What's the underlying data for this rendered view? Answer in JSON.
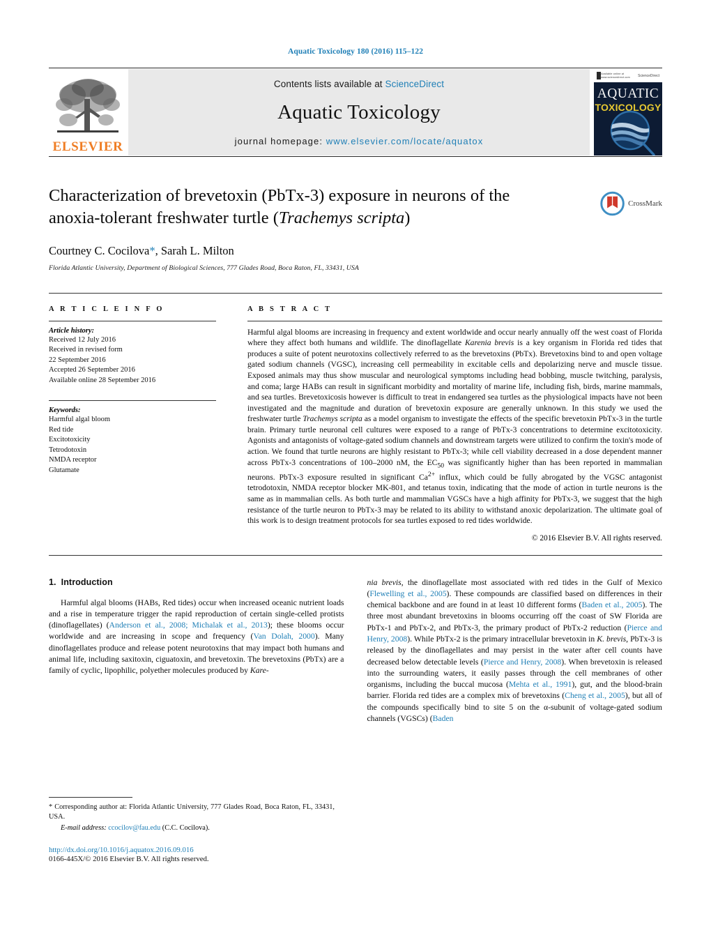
{
  "running_head": "Aquatic Toxicology 180 (2016) 115–122",
  "banner": {
    "publisher_name": "ELSEVIER",
    "contents_prefix": "Contents lists available at ",
    "contents_link": "ScienceDirect",
    "journal_title": "Aquatic Toxicology",
    "homepage_prefix": "journal homepage: ",
    "homepage_url": "www.elsevier.com/locate/aquatox",
    "cover": {
      "line1": "AQUATIC",
      "line2": "TOXICOLOGY",
      "masthead_small": "Available online at www.sciencedirect.com",
      "masthead_right": "ScienceDirect"
    }
  },
  "article": {
    "title_line1": "Characterization of brevetoxin (PbTx-3) exposure in neurons of the",
    "title_line2_pre": "anoxia-tolerant freshwater turtle (",
    "title_line2_italic": "Trachemys scripta",
    "title_line2_post": ")",
    "authors_pre": "Courtney C. Cocilova",
    "authors_star": "*",
    "authors_post": ", Sarah L. Milton",
    "affiliation": "Florida Atlantic University, Department of Biological Sciences, 777 Glades Road, Boca Raton, FL, 33431, USA",
    "crossmark_label": "CrossMark"
  },
  "article_info": {
    "heading": "A R T I C L E   I N F O",
    "history_label": "Article history:",
    "history_lines": [
      "Received 12 July 2016",
      "Received in revised form",
      "22 September 2016",
      "Accepted 26 September 2016",
      "Available online 28 September 2016"
    ],
    "keywords_label": "Keywords:",
    "keywords": [
      "Harmful algal bloom",
      "Red tide",
      "Excitotoxicity",
      "Tetrodotoxin",
      "NMDA receptor",
      "Glutamate"
    ]
  },
  "abstract": {
    "heading": "A B S T R A C T",
    "part1": "Harmful algal blooms are increasing in frequency and extent worldwide and occur nearly annually off the west coast of Florida where they affect both humans and wildlife. The dinoflagellate ",
    "italic1": "Karenia brevis",
    "part2": " is a key organism in Florida red tides that produces a suite of potent neurotoxins collectively referred to as the brevetoxins (PbTx). Brevetoxins bind to and open voltage gated sodium channels (VGSC), increasing cell permeability in excitable cells and depolarizing nerve and muscle tissue. Exposed animals may thus show muscular and neurological symptoms including head bobbing, muscle twitching, paralysis, and coma; large HABs can result in significant morbidity and mortality of marine life, including fish, birds, marine mammals, and sea turtles. Brevetoxicosis however is difficult to treat in endangered sea turtles as the physiological impacts have not been investigated and the magnitude and duration of brevetoxin exposure are generally unknown. In this study we used the freshwater turtle ",
    "italic2": "Trachemys scripta",
    "part3": " as a model organism to investigate the effects of the specific brevetoxin PbTx-3 in the turtle brain. Primary turtle neuronal cell cultures were exposed to a range of PbTx-3 concentrations to determine excitotoxicity. Agonists and antagonists of voltage-gated sodium channels and downstream targets were utilized to confirm the toxin's mode of action. We found that turtle neurons are highly resistant to PbTx-3; while cell viability decreased in a dose dependent manner across PbTx-3 concentrations of 100–2000 nM, the EC",
    "sub1": "50",
    "part4": " was significantly higher than has been reported in mammalian neurons. PbTx-3 exposure resulted in significant Ca",
    "sup1": "2+",
    "part5": " influx, which could be fully abrogated by the VGSC antagonist tetrodotoxin, NMDA receptor blocker MK-801, and tetanus toxin, indicating that the mode of action in turtle neurons is the same as in mammalian cells. As both turtle and mammalian VGSCs have a high affinity for PbTx-3, we suggest that the high resistance of the turtle neuron to PbTx-3 may be related to its ability to withstand anoxic depolarization. The ultimate goal of this work is to design treatment protocols for sea turtles exposed to red tides worldwide.",
    "copyright": "© 2016 Elsevier B.V. All rights reserved."
  },
  "introduction": {
    "number": "1.",
    "title": "Introduction",
    "left_p1_a": "Harmful algal blooms (HABs, Red tides) occur when increased oceanic nutrient loads and a rise in temperature trigger the rapid reproduction of certain single-celled protists (dinoflagellates) (",
    "left_cite1": "Anderson et al., 2008; Michalak et al., 2013",
    "left_p1_b": "); these blooms occur worldwide and are increasing in scope and frequency (",
    "left_cite2": "Van Dolah, 2000",
    "left_p1_c": "). Many dinoflagellates produce and release potent neurotoxins that may impact both humans and animal life, including saxitoxin, ciguatoxin, and brevetoxin. The brevetoxins (PbTx) are a family of cyclic, lipophilic, polyether molecules produced by ",
    "left_p1_ital": "Kare-",
    "right_p1_ital": "nia brevis",
    "right_p1_a": ", the dinoflagellate most associated with red tides in the Gulf of Mexico (",
    "right_cite1": "Flewelling et al., 2005",
    "right_p1_b": "). These compounds are classified based on differences in their chemical backbone and are found in at least 10 different forms (",
    "right_cite2": "Baden et al., 2005",
    "right_p1_c": "). The three most abundant brevetoxins in blooms occurring off the coast of SW Florida are PbTx-1 and PbTx-2, and PbTx-3, the primary product of PbTx-2 reduction (",
    "right_cite3": "Pierce and Henry, 2008",
    "right_p1_d": "). While PbTx-2 is the primary intracellular brevetoxin in ",
    "right_p1_ital2": "K. brevis",
    "right_p1_e": ", PbTx-3 is released by the dinoflagellates and may persist in the water after cell counts have decreased below detectable levels (",
    "right_cite4": "Pierce and Henry, 2008",
    "right_p1_f": "). When brevetoxin is released into the surrounding waters, it easily passes through the cell membranes of other organisms, including the buccal mucosa (",
    "right_cite5": "Mehta et al., 1991",
    "right_p1_g": "), gut, and the blood-brain barrier. Florida red tides are a complex mix of brevetoxins (",
    "right_cite6": "Cheng et al., 2005",
    "right_p1_h": "), but all of the compounds specifically bind to site 5 on the α-subunit of voltage-gated sodium channels (VGSCs) (",
    "right_cite7": "Baden"
  },
  "footnote": {
    "corresponding": "* Corresponding author at: Florida Atlantic University, 777 Glades Road, Boca Raton, FL, 33431, USA.",
    "email_label": "E-mail address:",
    "email": "ccocilov@fau.edu",
    "email_suffix": "(C.C. Cocilova).",
    "doi": "http://dx.doi.org/10.1016/j.aquatox.2016.09.016",
    "issn": "0166-445X/© 2016 Elsevier B.V. All rights reserved."
  },
  "colors": {
    "link_blue": "#1f7fb6",
    "elsevier_orange": "#ef7d24",
    "cover_navy": "#0d1b33",
    "cover_gold": "#e6c832"
  }
}
